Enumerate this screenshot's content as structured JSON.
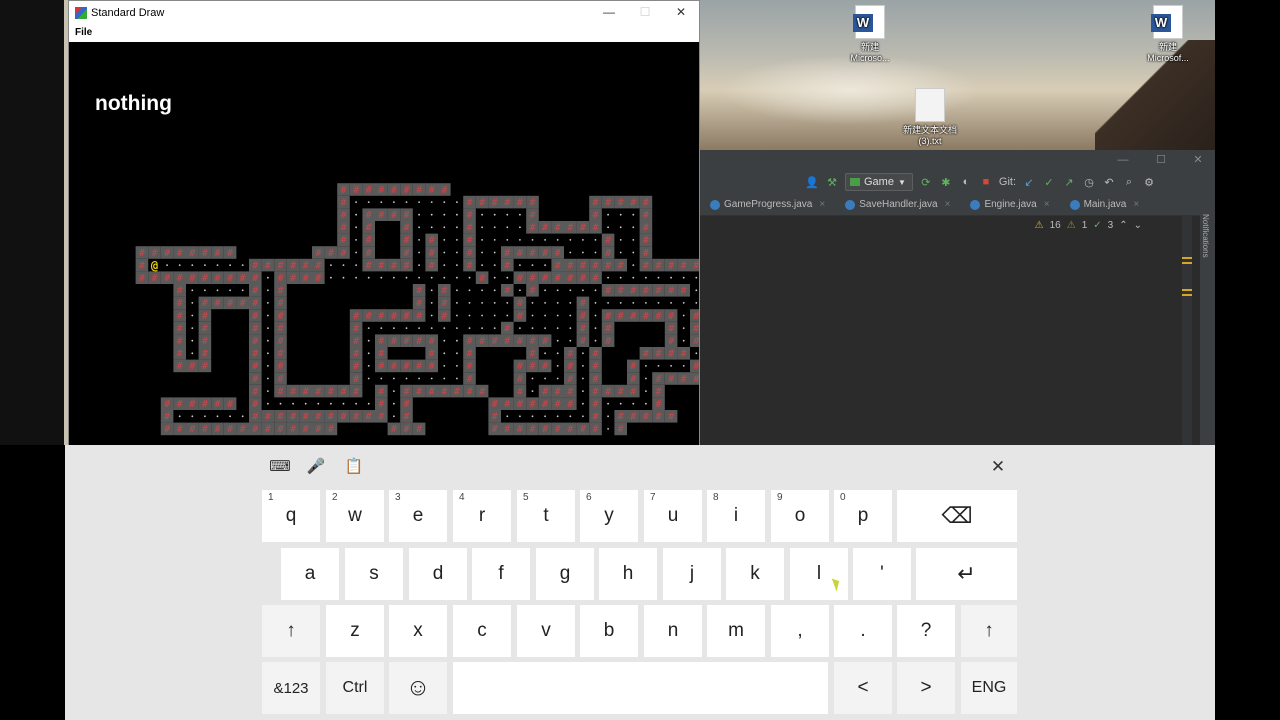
{
  "desktop": {
    "icons": [
      {
        "label1": "新建",
        "label2": "Microso..."
      },
      {
        "label1": "新建文本文档",
        "label2": "(3).txt"
      },
      {
        "label1": "新建",
        "label2": "Microsof..."
      }
    ]
  },
  "std_draw": {
    "title": "Standard Draw",
    "menu_file": "File",
    "status_text": "nothing",
    "player_glyph": "@",
    "wall_glyph": "#",
    "floor_glyph": "·",
    "colors": {
      "wall": "#c8474b",
      "wall_bg": "#5a5a5a",
      "floor": "#d0d0d0",
      "player": "#e8d21a"
    },
    "minimize": "—",
    "maximize": "☐",
    "close": "✕"
  },
  "ide": {
    "run_config": "Game",
    "git_label": "Git:",
    "tabs": [
      {
        "label": "GameProgress.java"
      },
      {
        "label": "SaveHandler.java"
      },
      {
        "label": "Engine.java"
      },
      {
        "label": "Main.java"
      }
    ],
    "inspect": {
      "warnings": "16",
      "weak": "1",
      "ok": "3"
    },
    "side_panel": "Notifications"
  },
  "keyboard": {
    "toolbar": {
      "settings": "⌨",
      "mic": "🎤",
      "clipboard": "📋",
      "close": "✕"
    },
    "row1": [
      {
        "k": "q",
        "n": "1"
      },
      {
        "k": "w",
        "n": "2"
      },
      {
        "k": "e",
        "n": "3"
      },
      {
        "k": "r",
        "n": "4"
      },
      {
        "k": "t",
        "n": "5"
      },
      {
        "k": "y",
        "n": "6"
      },
      {
        "k": "u",
        "n": "7"
      },
      {
        "k": "i",
        "n": "8"
      },
      {
        "k": "o",
        "n": "9"
      },
      {
        "k": "p",
        "n": "0"
      }
    ],
    "backspace": "⌫",
    "row2": [
      "a",
      "s",
      "d",
      "f",
      "g",
      "h",
      "j",
      "k",
      "l",
      "'"
    ],
    "enter": "↵",
    "shift": "↑",
    "row3": [
      "z",
      "x",
      "c",
      "v",
      "b",
      "n",
      "m",
      ",",
      ".",
      "?"
    ],
    "sym": "&123",
    "ctrl": "Ctrl",
    "emoji": "☺",
    "left": "<",
    "right": ">",
    "lang": "ENG"
  }
}
